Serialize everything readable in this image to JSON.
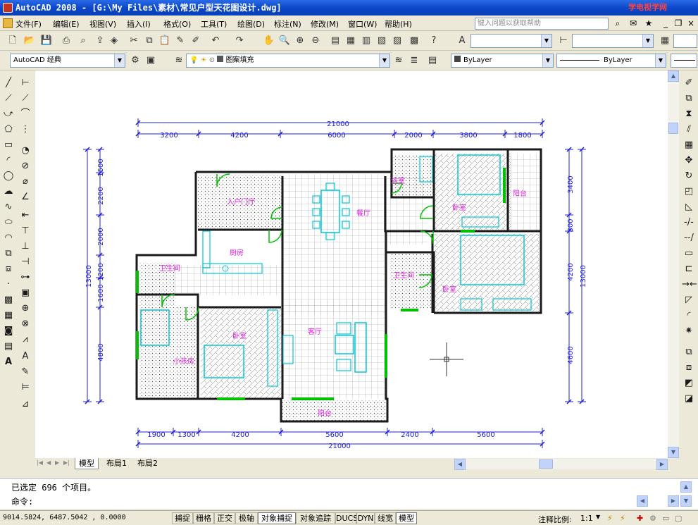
{
  "window": {
    "title": "AutoCAD 2008 - [G:\\My Files\\素材\\常见户型天花图设计.dwg]",
    "watermark": "学电视学网"
  },
  "menu": {
    "items": [
      "文件(F)",
      "编辑(E)",
      "视图(V)",
      "插入(I)",
      "格式(O)",
      "工具(T)",
      "绘图(D)",
      "标注(N)",
      "修改(M)",
      "窗口(W)",
      "帮助(H)"
    ],
    "help_placeholder": "键入问题以获取帮助"
  },
  "toolbar2": {
    "workspace": "AutoCAD 经典",
    "layer": "图案填充",
    "color": "ByLayer",
    "linetype": "ByLayer"
  },
  "drawing": {
    "dims_top": [
      "3200",
      "4200",
      "6000",
      "2000",
      "3800",
      "1800"
    ],
    "dims_top_total": "21000",
    "dims_bottom": [
      "1900",
      "1300",
      "4200",
      "5600",
      "2400",
      "5600"
    ],
    "dims_bottom_total": "21000",
    "dims_left_total": "13000",
    "dims_left": [
      "1500",
      "2200",
      "2000",
      "1200",
      "1600",
      "4800"
    ],
    "dims_right": [
      "3400",
      "800",
      "4200",
      "4600"
    ],
    "dims_right_total": "13000",
    "rooms": [
      "入户门厅",
      "餐厅",
      "厨房",
      "卫生间",
      "客厅",
      "卧室",
      "小孩房",
      "阳台",
      "浴室",
      "卧室",
      "阳台",
      "卫生间",
      "卧室"
    ],
    "colors": {
      "wall": "#1a1a1a",
      "dim": "#2020d0",
      "furniture": "#00c8d8",
      "label": "#e020e0",
      "window": "#00c000",
      "hatch": "#9a9a9a"
    }
  },
  "tabs": {
    "items": [
      "模型",
      "布局1",
      "布局2"
    ],
    "active": "模型"
  },
  "command": {
    "history": "已选定 696 个项目。",
    "prompt": "命令:"
  },
  "status": {
    "coords": "9014.5824,  6487.5042 , 0.0000",
    "toggles": [
      "捕捉",
      "栅格",
      "正交",
      "极轴",
      "对象捕捉",
      "对象追踪",
      "DUCS",
      "DYN",
      "线宽",
      "模型"
    ],
    "annotation_scale_label": "注释比例:",
    "annotation_scale": "1:1"
  }
}
